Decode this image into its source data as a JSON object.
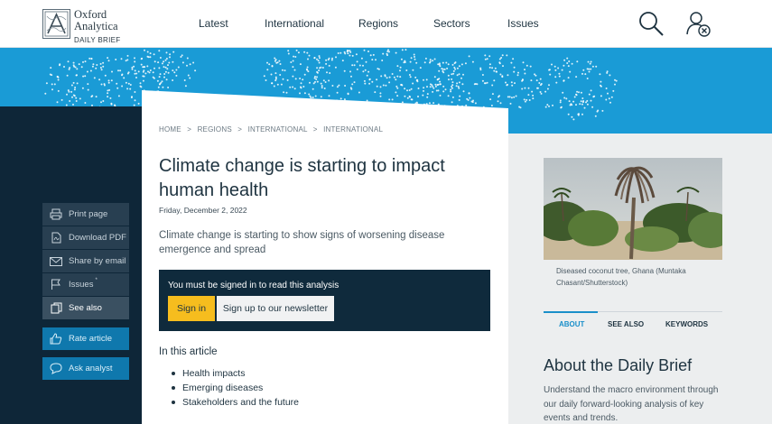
{
  "header": {
    "logo": {
      "line1": "Oxford",
      "line2": "Analytica",
      "line3": "DAILY BRIEF"
    },
    "nav": [
      "Latest",
      "International",
      "Regions",
      "Sectors",
      "Issues"
    ],
    "icons": [
      "search-icon",
      "account-icon"
    ]
  },
  "sidebar": {
    "actions": [
      {
        "label": "Print page",
        "icon": "printer-icon"
      },
      {
        "label": "Download PDF",
        "icon": "pdf-icon"
      },
      {
        "label": "Share by email",
        "icon": "email-icon"
      },
      {
        "label": "Issues",
        "icon": "flag-icon",
        "badge": "*"
      },
      {
        "label": "See also",
        "icon": "docs-icon",
        "active": true
      }
    ],
    "secondary": [
      {
        "label": "Rate article",
        "icon": "thumbs-up-icon"
      },
      {
        "label": "Ask analyst",
        "icon": "chat-icon"
      }
    ]
  },
  "article": {
    "breadcrumb": [
      "HOME",
      "REGIONS",
      "INTERNATIONAL",
      "INTERNATIONAL"
    ],
    "breadcrumb_sep": ">",
    "title": "Climate change is starting to impact human health",
    "date": "Friday, December 2, 2022",
    "summary": "Climate change is starting to show signs of worsening disease emergence and spread",
    "signin_box": {
      "message": "You must be signed in to read this analysis",
      "signin_label": "Sign in",
      "newsletter_label": "Sign up to our newsletter"
    },
    "in_this_article": {
      "heading": "In this article",
      "items": [
        "Health impacts",
        "Emerging diseases",
        "Stakeholders and the future"
      ]
    }
  },
  "aside": {
    "caption": "Diseased coconut tree, Ghana (Muntaka Chasant/Shutterstock)",
    "tabs": [
      {
        "label": "ABOUT",
        "active": true
      },
      {
        "label": "SEE ALSO",
        "active": false
      },
      {
        "label": "KEYWORDS",
        "active": false
      }
    ],
    "about_title": "About the Daily Brief",
    "about_text": "Understand the macro environment through our daily forward-looking analysis of key events and trends."
  },
  "colors": {
    "brand_blue": "#1a9bd6",
    "navy": "#0e2638",
    "accent_yellow": "#f6bd1e",
    "tab_active": "#1a8fc9"
  }
}
